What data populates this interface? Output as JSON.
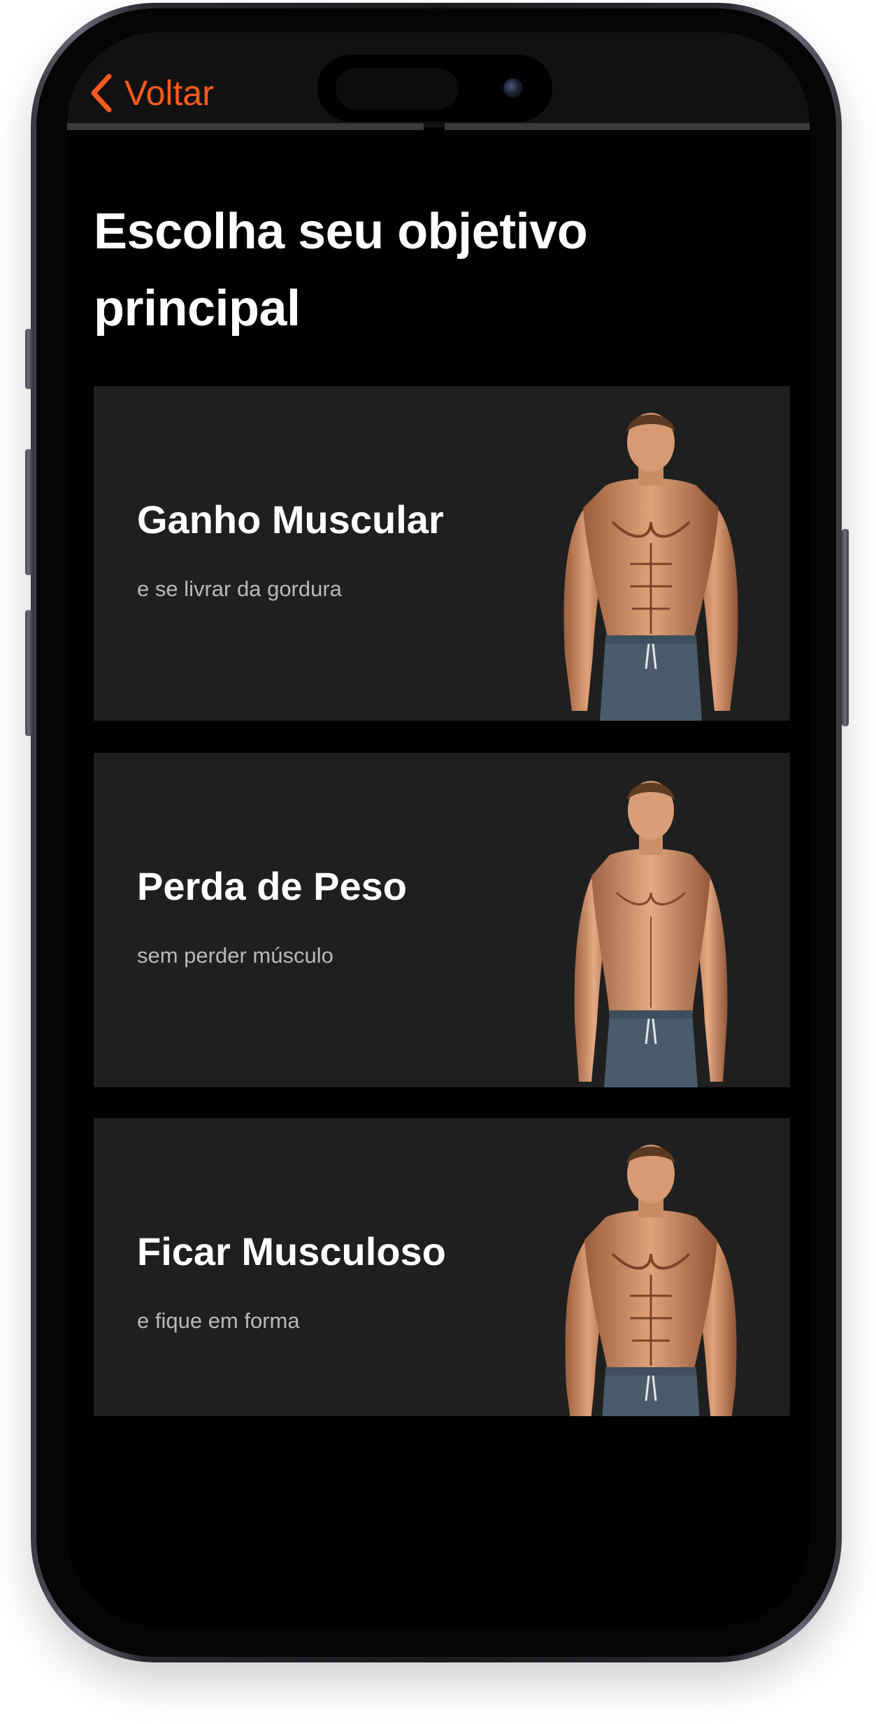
{
  "nav": {
    "back_label": "Voltar"
  },
  "page": {
    "title": "Escolha seu objetivo principal"
  },
  "goals": [
    {
      "title": "Ganho Muscular",
      "subtitle": "e se livrar da gordura",
      "figure": "muscular-man-illustration"
    },
    {
      "title": "Perda de Peso",
      "subtitle": "sem perder músculo",
      "figure": "lean-man-illustration"
    },
    {
      "title": "Ficar Musculoso",
      "subtitle": "e fique em forma",
      "figure": "muscular-man-illustration"
    }
  ],
  "colors": {
    "accent": "#ff5a1f",
    "background": "#000000",
    "card": "#1f1f1f",
    "subtitle": "#b9b9b9"
  }
}
